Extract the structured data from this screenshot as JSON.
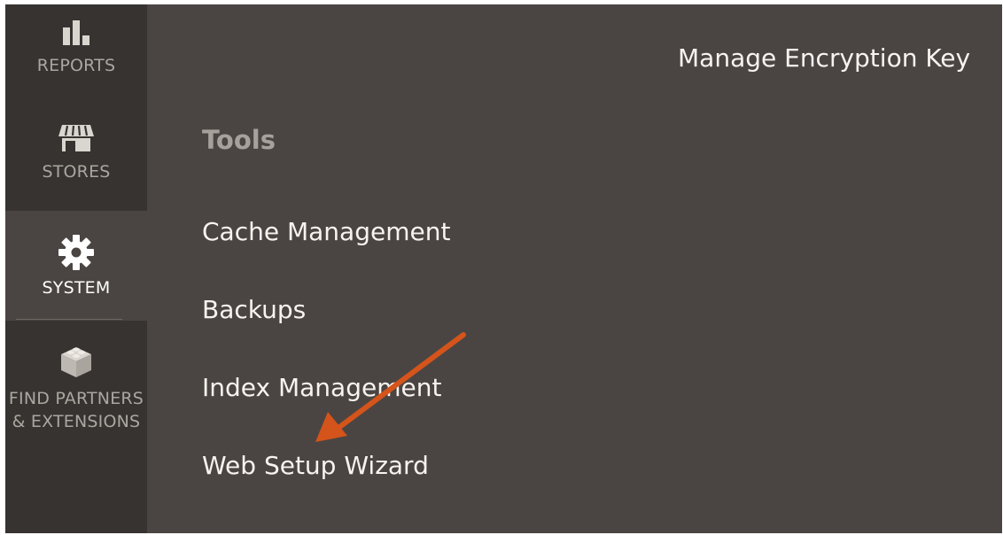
{
  "sidebar": {
    "items": [
      {
        "label": "REPORTS",
        "icon": "bar-chart-icon"
      },
      {
        "label": "STORES",
        "icon": "storefront-icon"
      },
      {
        "label": "SYSTEM",
        "icon": "gear-icon",
        "active": true
      },
      {
        "label": "FIND PARTNERS\n& EXTENSIONS",
        "icon": "lego-brick-icon"
      }
    ]
  },
  "menu": {
    "top_link": "Manage Encryption Key",
    "section_title": "Tools",
    "links": [
      "Cache Management",
      "Backups",
      "Index Management",
      "Web Setup Wizard"
    ]
  },
  "annotation": {
    "arrow_color": "#d4541b",
    "points_to": "Web Setup Wizard"
  },
  "colors": {
    "sidebar_bg": "#373330",
    "panel_bg": "#4a4542",
    "active_item_bg": "#4a4542",
    "link_text": "#f7f3ee",
    "section_title_text": "#a6a19b",
    "sidebar_text": "#aaa6a0"
  }
}
